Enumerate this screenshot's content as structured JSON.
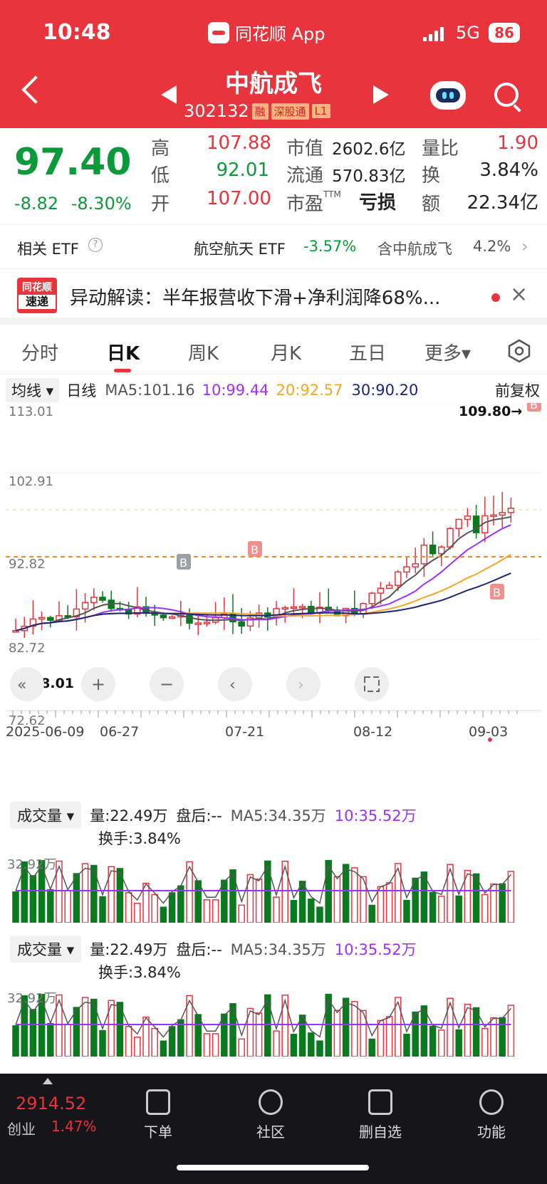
{
  "status": {
    "time": "10:48",
    "app": "同花顺 App",
    "network": "5G",
    "battery": "86"
  },
  "stock": {
    "name": "中航成飞",
    "code": "302132",
    "tags": [
      "融",
      "深股通",
      "L1"
    ]
  },
  "quote": {
    "price": "97.40",
    "change": "-8.82",
    "change_pct": "-8.30%",
    "high_label": "高",
    "high": "107.88",
    "low_label": "低",
    "low": "92.01",
    "open_label": "开",
    "open": "107.00",
    "mcap_label": "市值",
    "mcap": "2602.6亿",
    "float_label": "流通",
    "float": "570.83亿",
    "pe_label": "市盈",
    "pe_sup": "TTM",
    "pe": "亏损",
    "vr_label": "量比",
    "vr": "1.90",
    "turn_label": "换",
    "turn": "3.84%",
    "amt_label": "额",
    "amt": "22.34亿"
  },
  "etf": {
    "label": "相关 ETF",
    "name": "航空航天 ETF",
    "pct": "-3.57%",
    "holding": "含中航成飞",
    "weight": "4.2%"
  },
  "news": {
    "logo_top": "同花顺",
    "logo_bottom": "速递",
    "text": "异动解读：半年报营收下滑+净利润降68%..."
  },
  "tabs": [
    "分时",
    "日K",
    "周K",
    "月K",
    "五日",
    "更多▾"
  ],
  "ma": {
    "selector": "均线",
    "period": "日线",
    "ma5": "MA5:101.16",
    "ma10": "10:99.44",
    "ma20": "20:92.57",
    "ma30": "30:90.20",
    "adjust": "前复权"
  },
  "chart_data": {
    "type": "candlestick",
    "y_ticks": [
      "113.01",
      "102.91",
      "92.82",
      "82.72",
      "72.62"
    ],
    "x_ticks": [
      "2025-06-09",
      "06-27",
      "07-21",
      "08-12",
      "09-03"
    ],
    "max_label": "109.80→",
    "min_label": "←78.01",
    "buy_markers": [
      "B",
      "B",
      "B",
      "B"
    ],
    "colors": {
      "up": "#e8343d",
      "down": "#0b7a1f",
      "ma5": "#555555",
      "ma10": "#9b30ff",
      "ma20": "#f5a623",
      "ma30": "#1a237e"
    }
  },
  "volume": {
    "selector": "成交量",
    "vol": "量:22.49万",
    "after": "盘后:--",
    "ma5": "MA5:34.35万",
    "ma10": "10:35.52万",
    "turnover": "换手:3.84%",
    "axis": "32.92万"
  },
  "bottom": {
    "index_value": "2914.52",
    "index_name": "创业",
    "index_pct": "1.47%",
    "items": [
      "下单",
      "社区",
      "删自选",
      "功能"
    ]
  }
}
